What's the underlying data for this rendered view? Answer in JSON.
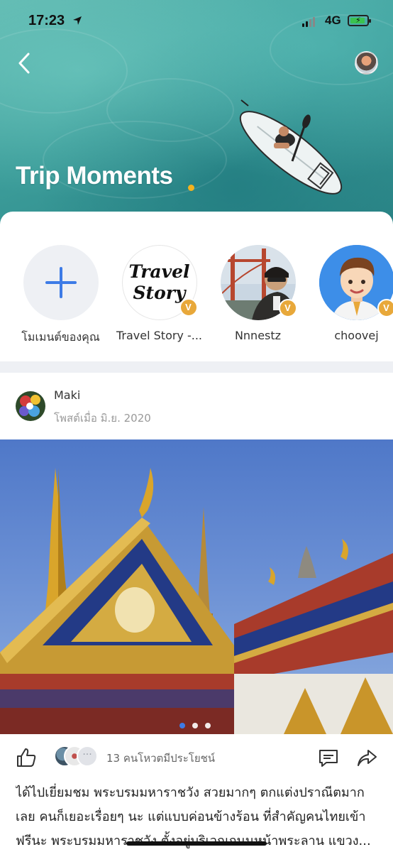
{
  "status_bar": {
    "time": "17:23",
    "network": "4G"
  },
  "header": {
    "title": "Trip Moments"
  },
  "stories": [
    {
      "label": "โมเมนต์ของคุณ",
      "icon": "plus-icon"
    },
    {
      "label": "Travel Story -...",
      "logo_line1": "Travel",
      "logo_line2": "Story",
      "badge": "V"
    },
    {
      "label": "Nnnestz",
      "badge": "V"
    },
    {
      "label": "choovej",
      "badge": "V"
    }
  ],
  "post": {
    "author": "Maki",
    "date": "โพสต์เมื่อ มิ.ย. 2020",
    "votes_text": "13 คนโหวตมีประโยชน์",
    "body_lines": [
      "ได้ไปเยี่ยมชม พระบรมมหาราชวัง สวยมากๆ ตกแต่งปราณีตมาก",
      "เลย คนก็เยอะเรื่อยๆ นะ แต่แบบค่อนข้างร้อน ที่สำคัญคนไทยเข้า",
      "ฟรีนะ พระบรมมหาราชวัง ตั้งอยู่บริเวณถนนหน้าพระลาน แขวง..."
    ],
    "image_count": 3,
    "active_image": 1
  },
  "colors": {
    "accent": "#3d7be6",
    "badge": "#e8a83a",
    "title_dot": "#f5b21d"
  }
}
